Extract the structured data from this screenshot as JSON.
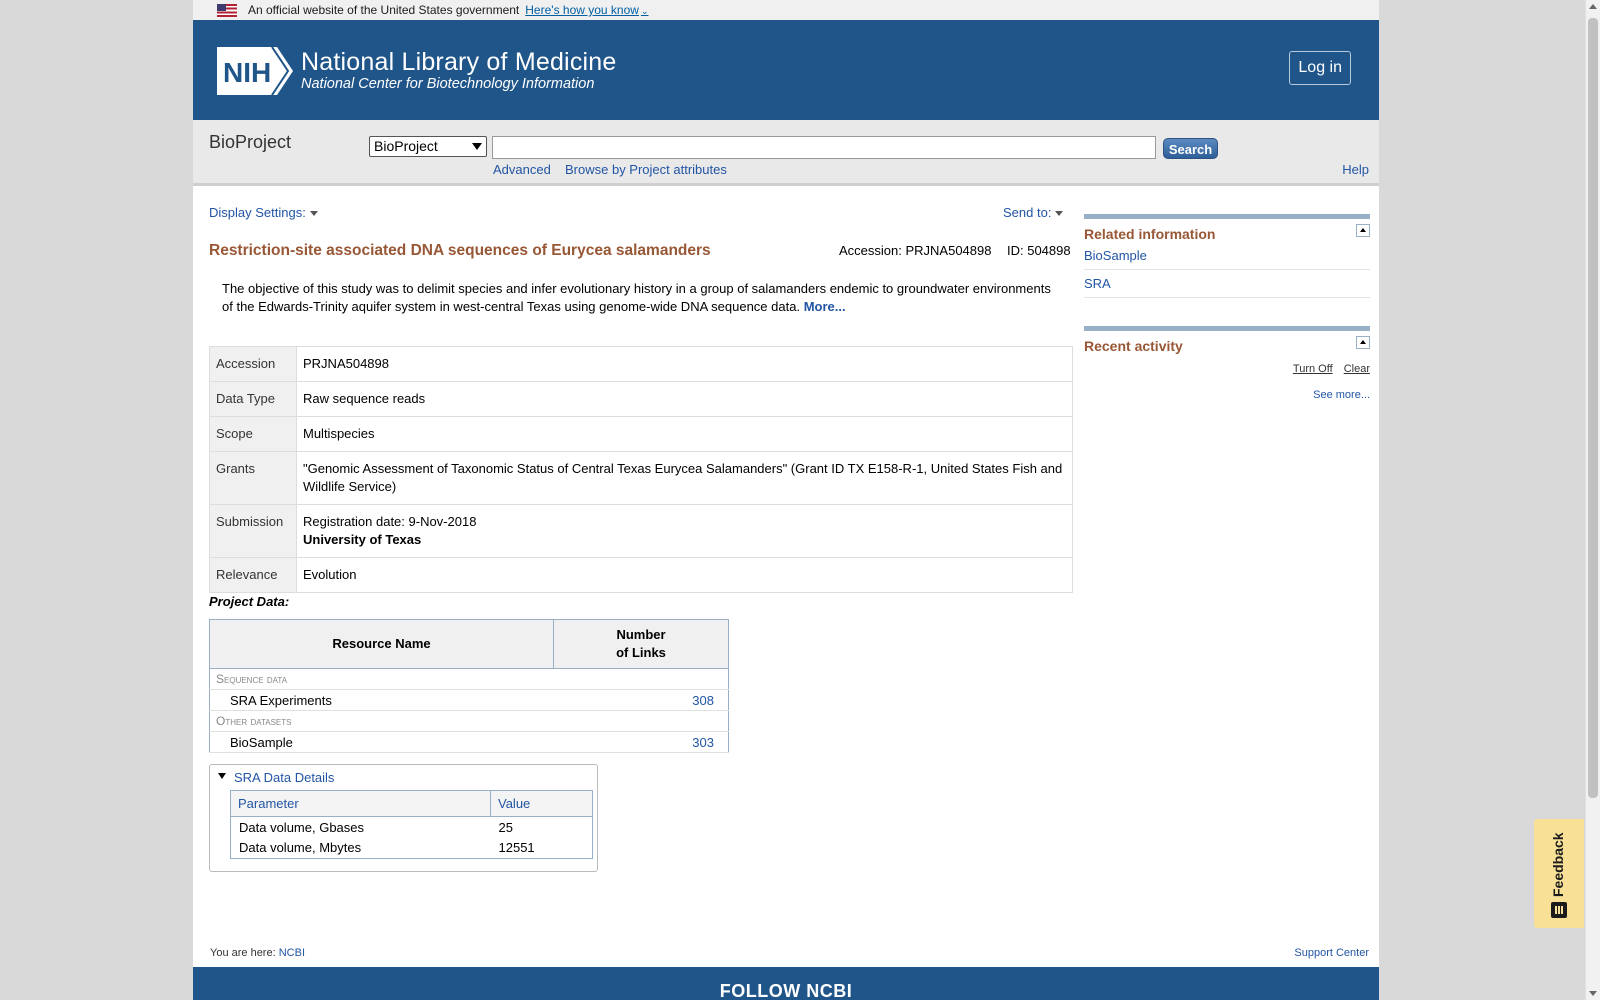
{
  "gov_banner": {
    "text": "An official website of the United States government",
    "link": "Here's how you know"
  },
  "header": {
    "badge": "NIH",
    "title": "National Library of Medicine",
    "subtitle": "National Center for Biotechnology Information",
    "login_label": "Log in"
  },
  "search": {
    "db_name": "BioProject",
    "db_selected": "BioProject",
    "query": "",
    "button_label": "Search",
    "advanced_label": "Advanced",
    "browse_label": "Browse by Project attributes",
    "help_label": "Help"
  },
  "toolbar": {
    "display_settings": "Display Settings:",
    "send_to": "Send to:"
  },
  "project": {
    "title": "Restriction-site associated DNA sequences of Eurycea salamanders",
    "accession_line": "Accession: PRJNA504898",
    "id_line": "ID: 504898",
    "abstract": "The objective of this study was to delimit species and infer evolutionary history in a group of salamanders endemic to groundwater environments of the Edwards-Trinity aquifer system in west-central Texas using genome-wide DNA sequence data.",
    "more_label": "More..."
  },
  "details": [
    {
      "label": "Accession",
      "value": "PRJNA504898"
    },
    {
      "label": "Data Type",
      "value": "Raw sequence reads"
    },
    {
      "label": "Scope",
      "value": "Multispecies"
    },
    {
      "label": "Grants",
      "value": "\"Genomic Assessment of Taxonomic Status of Central Texas Eurycea Salamanders\" (Grant ID TX E158-R-1, United States Fish and Wildlife Service)"
    },
    {
      "label": "Submission",
      "value": "Registration date: 9-Nov-2018",
      "value2": "University of Texas"
    },
    {
      "label": "Relevance",
      "value": "Evolution"
    }
  ],
  "project_data": {
    "label": "Project Data:",
    "col_resource": "Resource Name",
    "col_links_1": "Number",
    "col_links_2": "of Links",
    "sections": [
      {
        "name": "Sequence data",
        "rows": [
          {
            "name": "SRA Experiments",
            "count": "308"
          }
        ]
      },
      {
        "name": "Other datasets",
        "rows": [
          {
            "name": "BioSample",
            "count": "303"
          }
        ]
      }
    ]
  },
  "sra_details": {
    "toggle_label": "SRA Data Details",
    "col_param": "Parameter",
    "col_value": "Value",
    "rows": [
      {
        "param": "Data volume, Gbases",
        "value": "25"
      },
      {
        "param": "Data volume, Mbytes",
        "value": "12551"
      }
    ]
  },
  "sidebar": {
    "related_title": "Related information",
    "related_items": [
      "BioSample",
      "SRA"
    ],
    "recent_title": "Recent activity",
    "turn_off": "Turn Off",
    "clear": "Clear",
    "see_more": "See more..."
  },
  "footer": {
    "you_are_here": "You are here:",
    "ncbi": "NCBI",
    "support": "Support Center",
    "follow": "FOLLOW NCBI"
  },
  "feedback_label": "Feedback",
  "colors": {
    "nih_blue": "#20558a",
    "title_brown": "#985735",
    "link_blue": "#2255a4",
    "feedback_yellow": "#f8e197"
  }
}
